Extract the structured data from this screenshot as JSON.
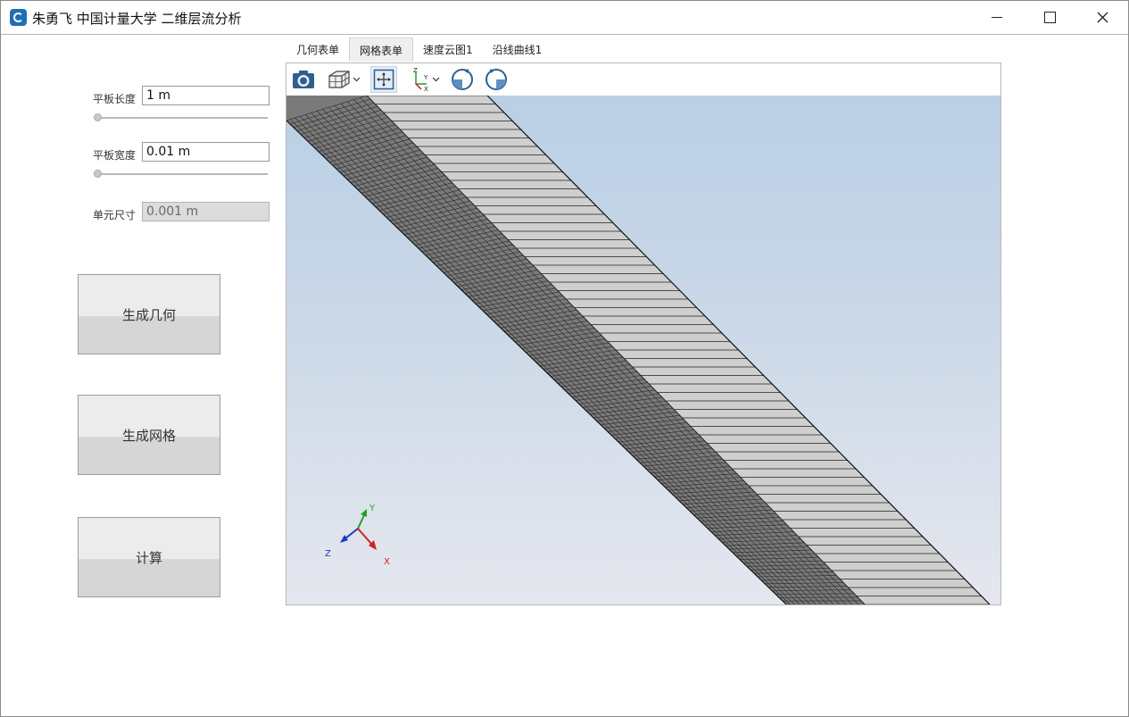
{
  "window": {
    "title": "朱勇飞 中国计量大学 二维层流分析",
    "icon": "app-logo-icon",
    "controls": [
      "minimize-icon",
      "maximize-icon",
      "close-icon"
    ]
  },
  "params": {
    "length_label": "平板长度",
    "length_value": "1 m",
    "width_label": "平板宽度",
    "width_value": "0.01 m",
    "cell_label": "单元尺寸",
    "cell_value": "0.001 m"
  },
  "buttons": {
    "geometry": "生成几何",
    "mesh": "生成网格",
    "compute": "计算"
  },
  "tabs": [
    {
      "label": "几何表单",
      "active": false
    },
    {
      "label": "网格表单",
      "active": true
    },
    {
      "label": "速度云图1",
      "active": false
    },
    {
      "label": "沿线曲线1",
      "active": false
    }
  ],
  "toolbar": [
    "camera-icon",
    "view-cube-icon",
    "fit-view-icon",
    "axes-orientation-icon",
    "rotate-cw-icon",
    "rotate-ccw-icon"
  ],
  "triad": {
    "x": "X",
    "y": "Y",
    "z": "Z"
  },
  "colors": {
    "viewport_top": "#bacfe5",
    "viewport_bottom": "#e5e7ee",
    "mesh_dense": "#7a7a7a",
    "mesh_light": "#cfcfcf",
    "axis_x": "#d11f1f",
    "axis_y": "#22a222",
    "axis_z": "#1f35c6"
  }
}
